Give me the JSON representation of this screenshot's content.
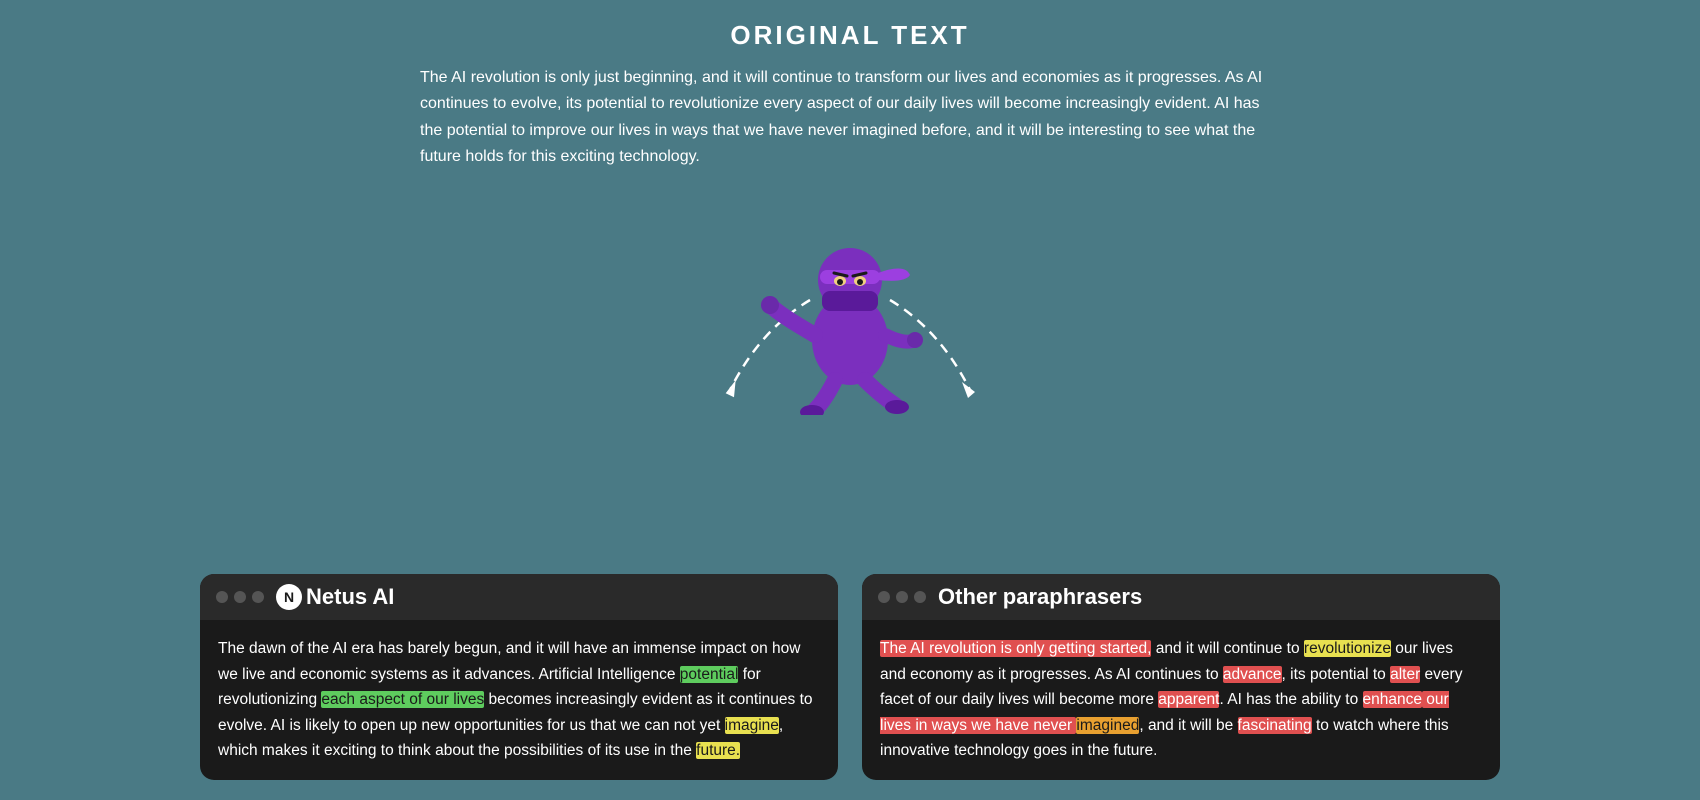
{
  "page": {
    "background_color": "#4a7a85",
    "title": "ORIGINAL TEXT",
    "original_text": "The AI revolution is only just beginning, and it will continue to transform our lives and economies as it progresses. As AI continues to evolve, its potential to revolutionize every aspect of our daily lives will become increasingly evident. AI has the potential to improve our lives in ways that we have never imagined before, and it will be interesting to see what the future holds for this exciting technology."
  },
  "panels": {
    "netus": {
      "title": "Netus AI",
      "logo_letter": "N",
      "dots": [
        "#555",
        "#555",
        "#555"
      ]
    },
    "other": {
      "title": "Other paraphrasers",
      "dots": [
        "#555",
        "#555",
        "#555"
      ]
    }
  },
  "netus_text_segments": [
    {
      "text": "The dawn of the AI era has barely begun, and it will have an immense impact on how we live and economic systems as it advances. Artificial Intelligence ",
      "highlight": "none"
    },
    {
      "text": "potential",
      "highlight": "yellow"
    },
    {
      "text": " for revolutionizing ",
      "highlight": "none"
    },
    {
      "text": "each aspect of our lives",
      "highlight": "green"
    },
    {
      "text": " becomes increasingly evident as it continues to evolve. AI is likely to open up new opportunities for us that we can not yet ",
      "highlight": "none"
    },
    {
      "text": "imagine",
      "highlight": "yellow"
    },
    {
      "text": ", which makes it exciting to think about the possibilities of its use in the ",
      "highlight": "none"
    },
    {
      "text": "future.",
      "highlight": "yellow"
    }
  ],
  "other_text_segments": [
    {
      "text": "The AI revolution is only getting started,",
      "highlight": "red"
    },
    {
      "text": " and it will continue to ",
      "highlight": "none"
    },
    {
      "text": "revolutionize",
      "highlight": "yellow"
    },
    {
      "text": " our lives and economy as it progresses. As AI continues to ",
      "highlight": "none"
    },
    {
      "text": "advance",
      "highlight": "red"
    },
    {
      "text": ", its potential to ",
      "highlight": "none"
    },
    {
      "text": "alter",
      "highlight": "red"
    },
    {
      "text": " every facet of our daily lives will become more ",
      "highlight": "none"
    },
    {
      "text": "apparent",
      "highlight": "red"
    },
    {
      "text": ". AI has the ability to ",
      "highlight": "none"
    },
    {
      "text": "enhance",
      "highlight": "red"
    },
    {
      "text": " our lives in ways we have never ",
      "highlight": "red"
    },
    {
      "text": "imagined",
      "highlight": "orange"
    },
    {
      "text": ", and it will be ",
      "highlight": "none"
    },
    {
      "text": "fascinating",
      "highlight": "red"
    },
    {
      "text": " to watch where this innovative technology goes in the future.",
      "highlight": "orange"
    }
  ]
}
